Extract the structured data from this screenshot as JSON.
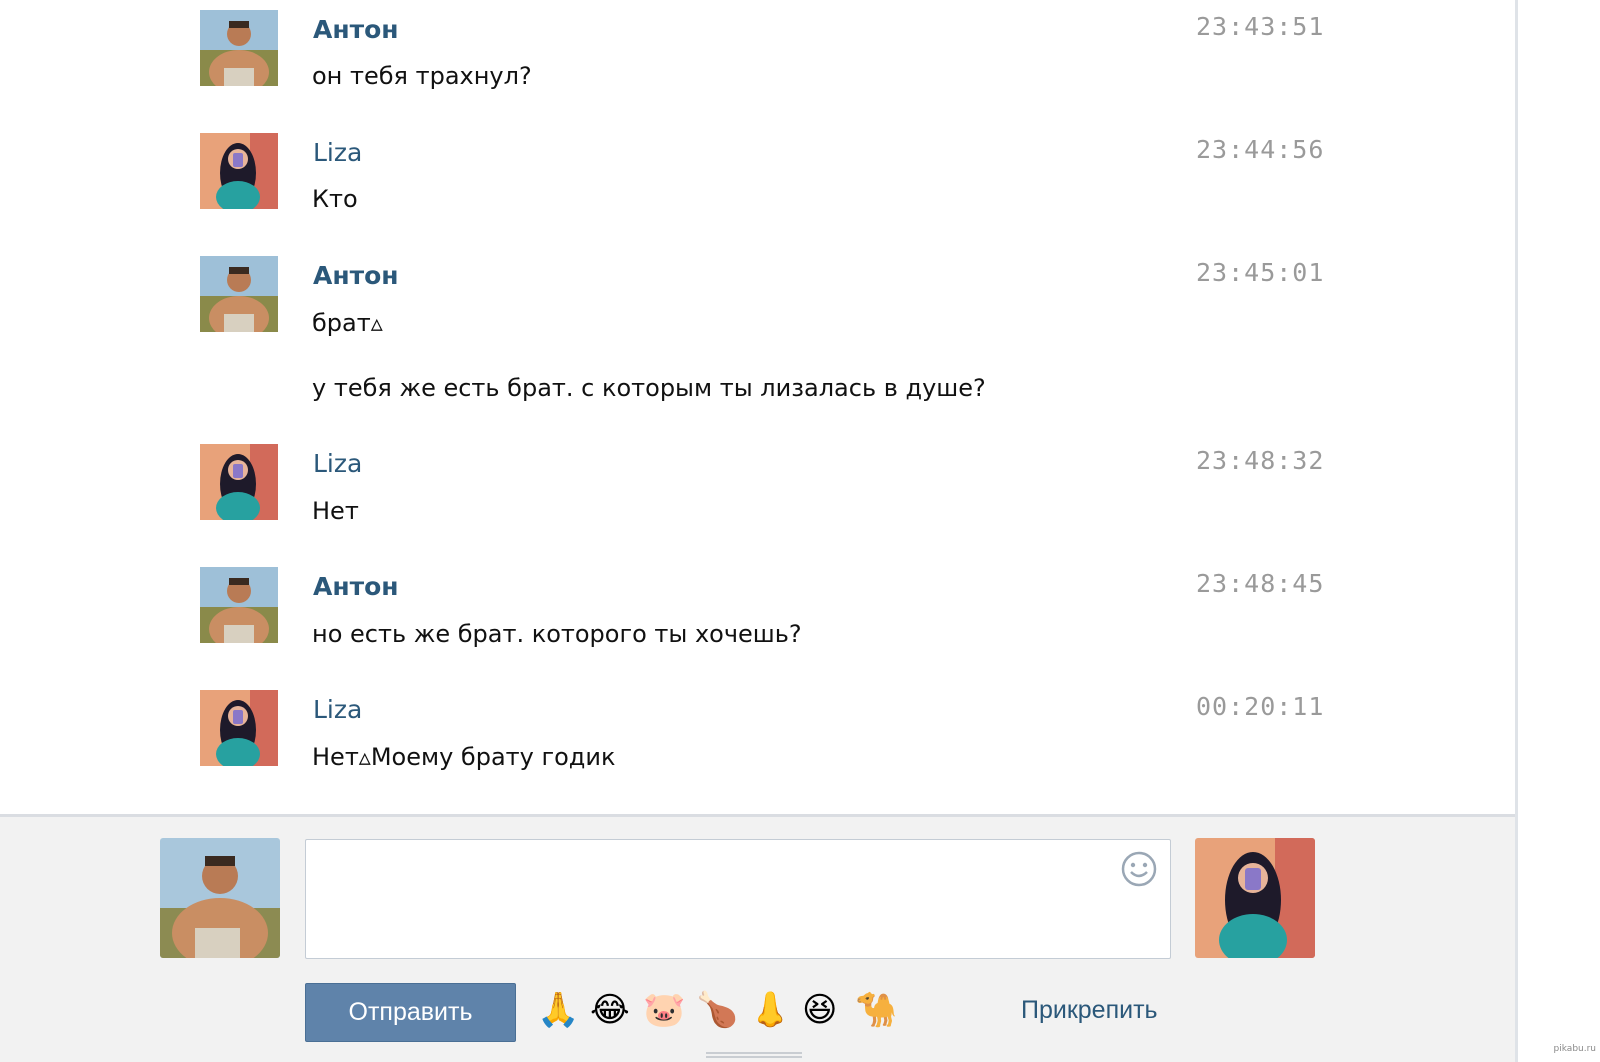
{
  "messages": [
    {
      "author": "Антон",
      "time": "23:43:51",
      "text": "он тебя трахнул?"
    },
    {
      "author": "Liza",
      "time": "23:44:56",
      "text": "Кто"
    },
    {
      "author": "Антон",
      "time": "23:45:01",
      "text": "брат▵",
      "text2": "у тебя же есть брат. с которым ты лизалась в душе?"
    },
    {
      "author": "Liza",
      "time": "23:48:32",
      "text": "Нет"
    },
    {
      "author": "Антон",
      "time": "23:48:45",
      "text": "но есть же брат. которого ты хочешь?"
    },
    {
      "author": "Liza",
      "time": "00:20:11",
      "text": "Нет▵Моему брату годик"
    }
  ],
  "compose": {
    "input_value": "",
    "send_label": "Отправить",
    "attach_label": "Прикрепить",
    "emojis": [
      "🙏",
      "😂",
      "🐷",
      "🍗",
      "👃",
      "😆",
      "🐪"
    ]
  },
  "watermark": "pikabu.ru",
  "colors": {
    "author": "#2b587a",
    "time": "#9a9a9a",
    "send_button": "#5f83aa",
    "compose_bg": "#f2f2f2"
  }
}
